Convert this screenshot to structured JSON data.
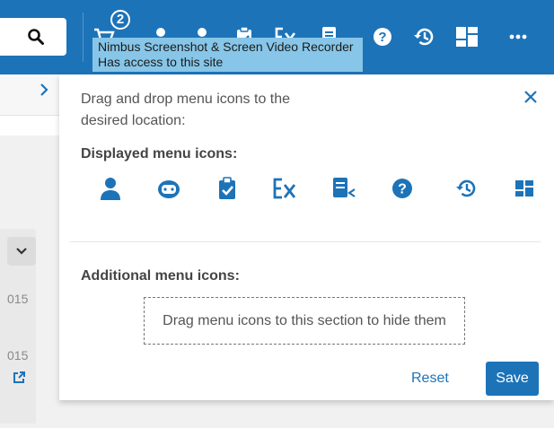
{
  "toolbar": {
    "badge_count": "2",
    "icons": [
      "search-icon",
      "cart-icon",
      "user-icon",
      "user-icon",
      "clipboard-check-icon",
      "excel-icon",
      "document-share-icon",
      "help-icon",
      "history-icon",
      "dashboard-icon",
      "more-icon"
    ]
  },
  "tooltip": {
    "line1": "Nimbus Screenshot & Screen Video Recorder",
    "line2": "Has access to this site"
  },
  "background": {
    "text1": "015",
    "text2": "015"
  },
  "panel": {
    "instructions": "Drag and drop menu icons to the desired location:",
    "displayed_title": "Displayed menu icons:",
    "displayed_icons": [
      "user-icon",
      "avatar-face-icon",
      "clipboard-check-icon",
      "excel-icon",
      "document-share-icon",
      "help-icon",
      "history-icon",
      "dashboard-icon"
    ],
    "additional_title": "Additional menu icons:",
    "dropzone_text": "Drag menu icons to this section to hide them",
    "reset_label": "Reset",
    "save_label": "Save"
  },
  "colors": {
    "brand_blue": "#1d73b8",
    "tooltip_bg": "#87c6e8"
  }
}
